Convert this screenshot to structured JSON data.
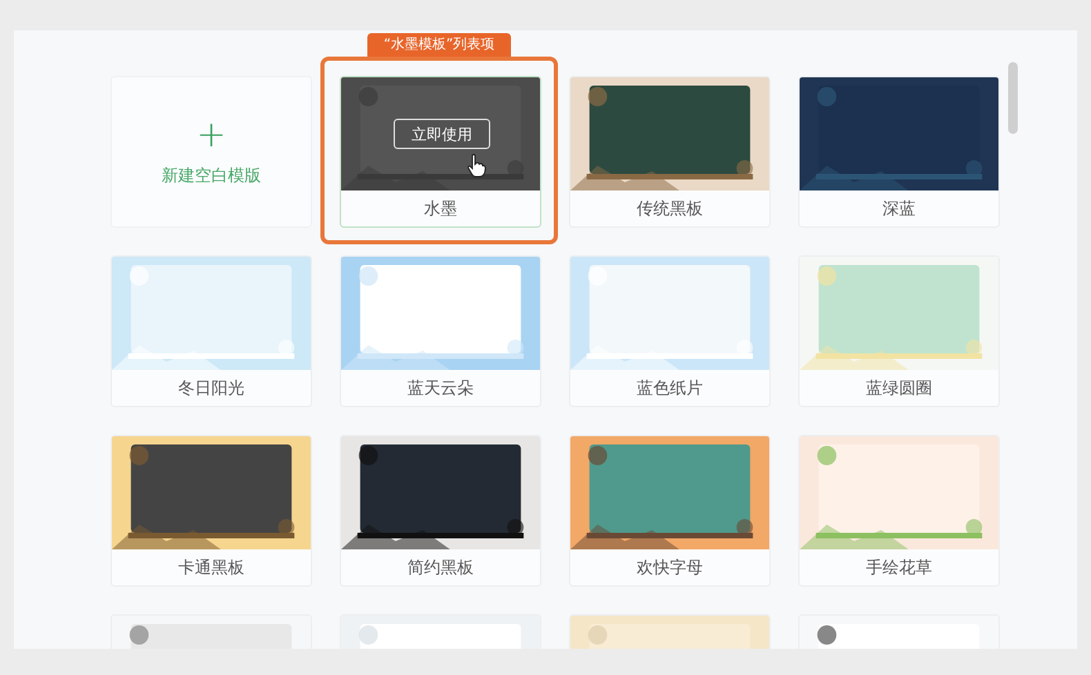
{
  "callout": {
    "label": "“水墨模板”列表项"
  },
  "templates": [
    {
      "kind": "blank",
      "label": "新建空白模版",
      "icon": "+"
    },
    {
      "kind": "template",
      "label": "水墨",
      "selected": true,
      "action": "立即使用"
    },
    {
      "kind": "template",
      "label": "传统黑板",
      "selected": false
    },
    {
      "kind": "template",
      "label": "深蓝",
      "selected": false
    },
    {
      "kind": "template",
      "label": "冬日阳光",
      "selected": false
    },
    {
      "kind": "template",
      "label": "蓝天云朵",
      "selected": false
    },
    {
      "kind": "template",
      "label": "蓝色纸片",
      "selected": false
    },
    {
      "kind": "template",
      "label": "蓝绿圆圈",
      "selected": false
    },
    {
      "kind": "template",
      "label": "卡通黑板",
      "selected": false
    },
    {
      "kind": "template",
      "label": "简约黑板",
      "selected": false
    },
    {
      "kind": "template",
      "label": "欢快字母",
      "selected": false
    },
    {
      "kind": "template",
      "label": "手绘花草",
      "selected": false
    },
    {
      "kind": "partial"
    },
    {
      "kind": "partial"
    },
    {
      "kind": "partial"
    },
    {
      "kind": "partial"
    }
  ]
}
